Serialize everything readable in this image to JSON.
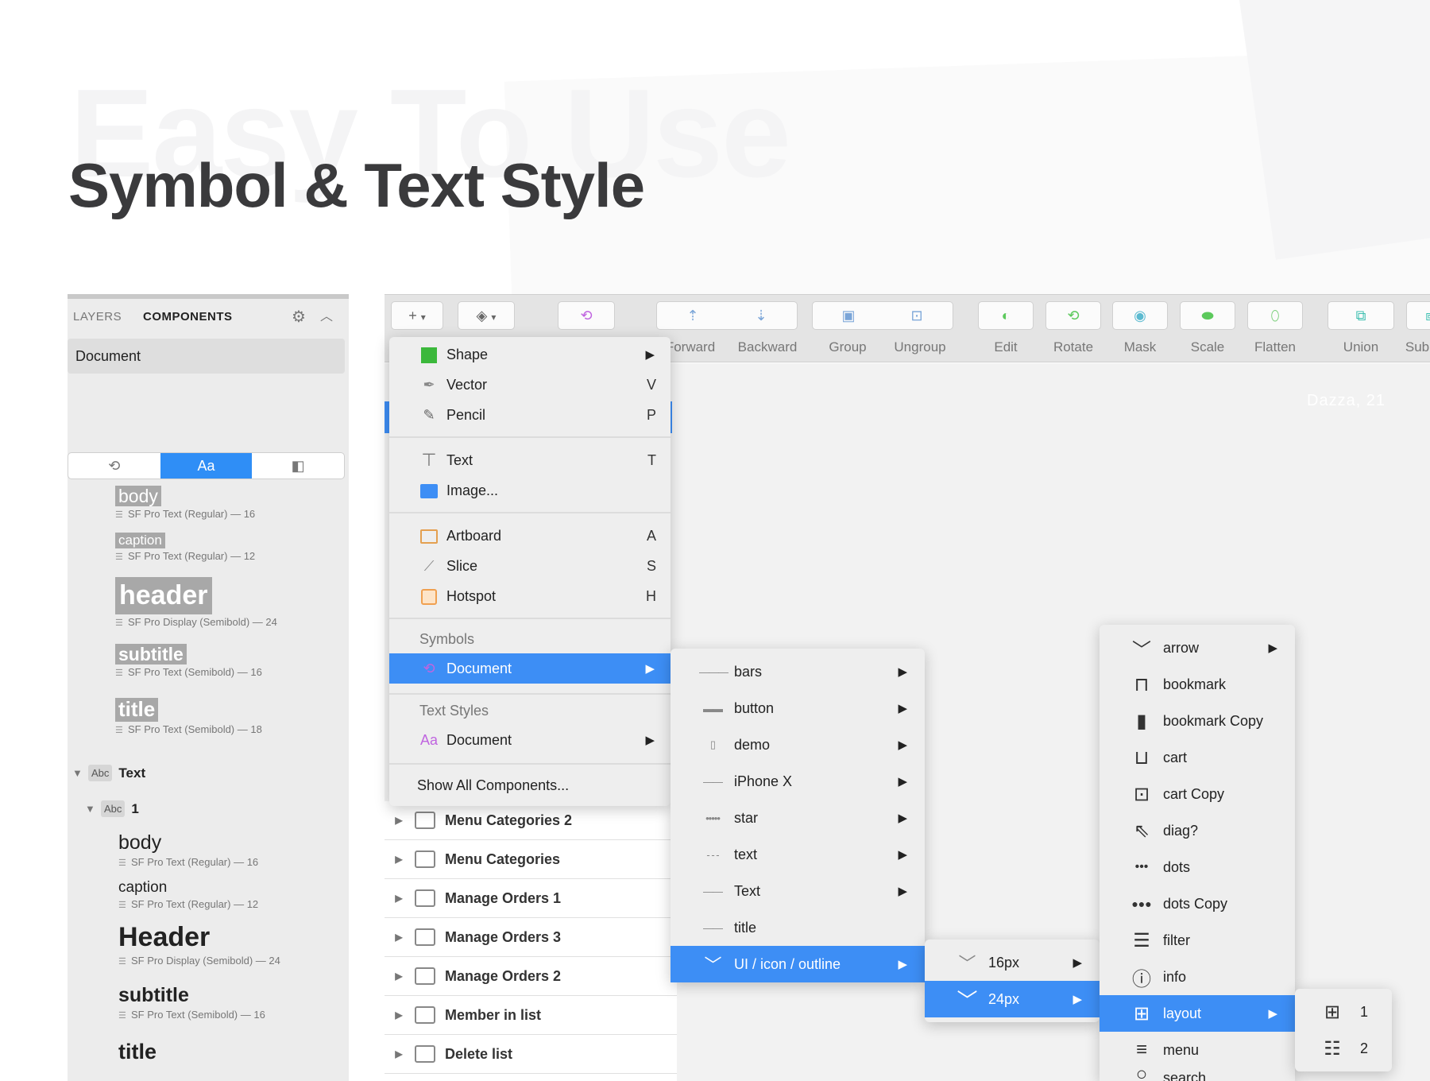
{
  "hero": {
    "watermark": "Easy To Use",
    "title": "Symbol & Text Style"
  },
  "left_panel": {
    "tab_layers": "LAYERS",
    "tab_components": "COMPONENTS",
    "document": "Document",
    "segments": [
      "",
      "Aa",
      ""
    ],
    "styles": [
      {
        "name": "body",
        "meta": "SF Pro Text (Regular) — 16"
      },
      {
        "name": "caption",
        "meta": "SF Pro Text (Regular) — 12"
      },
      {
        "name": "header",
        "meta": "SF Pro Display (Semibold) — 24"
      },
      {
        "name": "subtitle",
        "meta": "SF Pro Text (Semibold) — 16"
      },
      {
        "name": "title",
        "meta": "SF Pro Text (Semibold) — 18"
      }
    ],
    "tree_text": "Text",
    "tree_one": "1",
    "abc_badge": "Abc",
    "plain_styles": [
      {
        "name": "body",
        "meta": "SF Pro Text (Regular) — 16"
      },
      {
        "name": "caption",
        "meta": "SF Pro Text (Regular) — 12"
      },
      {
        "name": "Header",
        "meta": "SF Pro Display (Semibold) — 24"
      },
      {
        "name": "subtitle",
        "meta": "SF Pro Text (Semibold) — 16"
      },
      {
        "name": "title",
        "meta": ""
      }
    ]
  },
  "toolbar": {
    "labels": [
      "Forward",
      "Backward",
      "Group",
      "Ungroup",
      "Edit",
      "Rotate",
      "Mask",
      "Scale",
      "Flatten",
      "Union",
      "Sub"
    ],
    "canvas_hint": "Dazza, 21"
  },
  "insert_menu": {
    "items": [
      {
        "label": "Shape",
        "key": "",
        "icon": "shape-icon"
      },
      {
        "label": "Vector",
        "key": "V",
        "icon": "vector-pen-icon"
      },
      {
        "label": "Pencil",
        "key": "P",
        "icon": "pencil-icon"
      },
      {
        "label": "Text",
        "key": "T",
        "icon": "text-cursor-icon"
      },
      {
        "label": "Image...",
        "key": "",
        "icon": "image-icon"
      },
      {
        "label": "Artboard",
        "key": "A",
        "icon": "artboard-icon"
      },
      {
        "label": "Slice",
        "key": "S",
        "icon": "slice-icon"
      },
      {
        "label": "Hotspot",
        "key": "H",
        "icon": "hotspot-icon"
      }
    ],
    "symbols_section": "Symbols",
    "symbols_document": "Document",
    "text_styles_section": "Text Styles",
    "text_styles_document": "Document",
    "aa": "Aa",
    "show_all": "Show All Components..."
  },
  "layers": [
    "Menu Categories 2",
    "Menu Categories",
    "Manage Orders 1",
    "Manage Orders 3",
    "Manage Orders 2",
    "Member in list",
    "Delete list"
  ],
  "symbols_sub": {
    "items": [
      {
        "label": "bars",
        "sym": "———",
        "arrow": true
      },
      {
        "label": "button",
        "sym": "▬▬",
        "arrow": true
      },
      {
        "label": "demo",
        "sym": "▯",
        "arrow": true
      },
      {
        "label": "iPhone X",
        "sym": "——",
        "arrow": true
      },
      {
        "label": "star",
        "sym": "•••••",
        "arrow": true
      },
      {
        "label": "text",
        "sym": "- - -",
        "arrow": true
      },
      {
        "label": "Text",
        "sym": "——",
        "arrow": true
      },
      {
        "label": "title",
        "sym": "——",
        "arrow": false
      },
      {
        "label": "UI / icon / outline",
        "sym": "﹀",
        "arrow": true
      }
    ]
  },
  "size_sub": [
    "16px",
    "24px"
  ],
  "icon_sub": {
    "items": [
      {
        "label": "arrow",
        "glyph": "﹀",
        "arrow": true
      },
      {
        "label": "bookmark",
        "glyph": "⊓",
        "arrow": false
      },
      {
        "label": "bookmark Copy",
        "glyph": "▮",
        "arrow": false
      },
      {
        "label": "cart",
        "glyph": "⊔",
        "arrow": false
      },
      {
        "label": "cart Copy",
        "glyph": "⊡",
        "arrow": false
      },
      {
        "label": "diag?",
        "glyph": "⇖",
        "arrow": false
      },
      {
        "label": "dots",
        "glyph": "•••",
        "arrow": false
      },
      {
        "label": "dots Copy",
        "glyph": "●●●",
        "arrow": false
      },
      {
        "label": "filter",
        "glyph": "☰",
        "arrow": false
      },
      {
        "label": "info",
        "glyph": "ⓘ",
        "arrow": false
      },
      {
        "label": "layout",
        "glyph": "⊞",
        "arrow": true
      },
      {
        "label": "menu",
        "glyph": "≡",
        "arrow": false
      },
      {
        "label": "search",
        "glyph": "○",
        "arrow": false
      }
    ]
  },
  "layout_sub": [
    {
      "label": "1",
      "glyph": "⊞"
    },
    {
      "label": "2",
      "glyph": "☷"
    }
  ],
  "colors": {
    "accent": "#3d8ef5",
    "shape_green": "#3bb83b",
    "artboard_orange": "#f0a050",
    "aa_purple": "#c065e0"
  }
}
